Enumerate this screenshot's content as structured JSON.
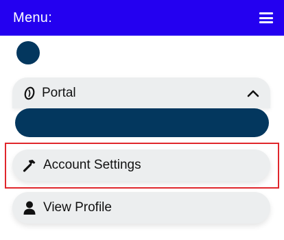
{
  "header": {
    "title": "Menu:"
  },
  "menu": {
    "portal_label": "Portal",
    "account_settings_label": "Account Settings",
    "view_profile_label": "View Profile"
  },
  "colors": {
    "header_bg": "#2400f0",
    "accent_navy": "#03375e",
    "item_bg": "#eceeef",
    "highlight_border": "#e0262b"
  },
  "icons": {
    "hamburger": "hamburger-menu-icon",
    "portal": "portal-swirl-icon",
    "chevron": "chevron-up-icon",
    "account_settings": "hammer-icon",
    "view_profile": "user-icon"
  }
}
